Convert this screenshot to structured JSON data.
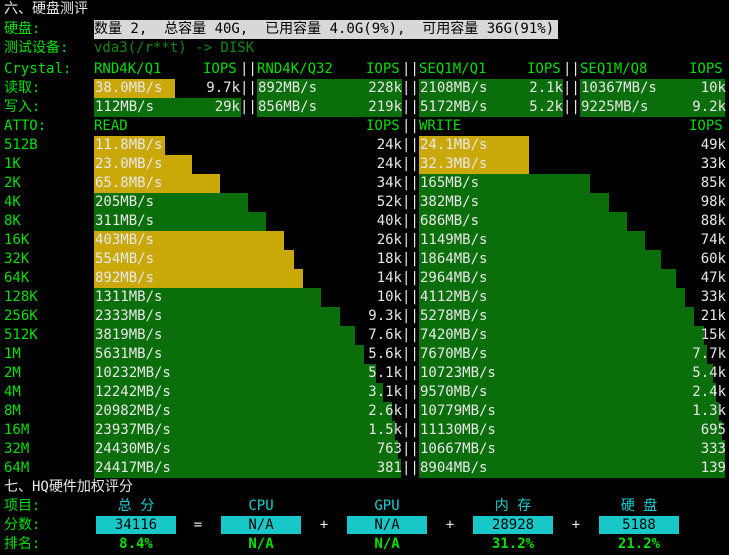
{
  "title": "六、硬盘测评",
  "disk_label": "硬盘:",
  "disk_summary": "数量 2,  总容量 40G,  已用容量 4.0G(9%),  可用容量 36G(91%)",
  "device_label": "测试设备:",
  "device_value": "vda3(/r**t) -> DISK",
  "crystal": {
    "label": "Crystal:",
    "headers": [
      "RND4K/Q1",
      "IOPS",
      "RND4K/Q32",
      "IOPS",
      "SEQ1M/Q1",
      "IOPS",
      "SEQ1M/Q8",
      "IOPS"
    ],
    "read_label": "读取:",
    "write_label": "写入:",
    "read": [
      {
        "speed": "38.0MB/s",
        "iops": "9.7k",
        "level": 0.55,
        "color": "yellow"
      },
      {
        "speed": "892MB/s",
        "iops": "228k",
        "level": 1.0,
        "color": "green"
      },
      {
        "speed": "2108MB/s",
        "iops": "2.1k",
        "level": 1.0,
        "color": "green"
      },
      {
        "speed": "10367MB/s",
        "iops": "10k",
        "level": 1.0,
        "color": "green"
      }
    ],
    "write": [
      {
        "speed": "112MB/s",
        "iops": "29k",
        "level": 1.0,
        "color": "green"
      },
      {
        "speed": "856MB/s",
        "iops": "219k",
        "level": 1.0,
        "color": "green"
      },
      {
        "speed": "5172MB/s",
        "iops": "5.2k",
        "level": 1.0,
        "color": "green"
      },
      {
        "speed": "9225MB/s",
        "iops": "9.2k",
        "level": 1.0,
        "color": "green"
      }
    ]
  },
  "atto": {
    "label": "ATTO:",
    "read_header": "READ",
    "write_header": "WRITE",
    "iops_header": "IOPS",
    "rows": [
      {
        "size": "512B",
        "read": "11.8MB/s",
        "read_iops": "24k",
        "read_level": 0.23,
        "read_color": "yellow",
        "write": "24.1MB/s",
        "write_iops": "49k",
        "write_level": 0.36,
        "write_color": "yellow"
      },
      {
        "size": "1K",
        "read": "23.0MB/s",
        "read_iops": "24k",
        "read_level": 0.32,
        "read_color": "yellow",
        "write": "32.3MB/s",
        "write_iops": "33k",
        "write_level": 0.36,
        "write_color": "yellow"
      },
      {
        "size": "2K",
        "read": "65.8MB/s",
        "read_iops": "34k",
        "read_level": 0.41,
        "read_color": "yellow",
        "write": "165MB/s",
        "write_iops": "85k",
        "write_level": 0.56,
        "write_color": "green"
      },
      {
        "size": "4K",
        "read": "205MB/s",
        "read_iops": "52k",
        "read_level": 0.5,
        "read_color": "green",
        "write": "382MB/s",
        "write_iops": "98k",
        "write_level": 0.62,
        "write_color": "green"
      },
      {
        "size": "8K",
        "read": "311MB/s",
        "read_iops": "40k",
        "read_level": 0.56,
        "read_color": "green",
        "write": "686MB/s",
        "write_iops": "88k",
        "write_level": 0.68,
        "write_color": "green"
      },
      {
        "size": "16K",
        "read": "403MB/s",
        "read_iops": "26k",
        "read_level": 0.62,
        "read_color": "yellow",
        "write": "1149MB/s",
        "write_iops": "74k",
        "write_level": 0.74,
        "write_color": "green"
      },
      {
        "size": "32K",
        "read": "554MB/s",
        "read_iops": "18k",
        "read_level": 0.65,
        "read_color": "yellow",
        "write": "1864MB/s",
        "write_iops": "60k",
        "write_level": 0.79,
        "write_color": "green"
      },
      {
        "size": "64K",
        "read": "892MB/s",
        "read_iops": "14k",
        "read_level": 0.68,
        "read_color": "yellow",
        "write": "2964MB/s",
        "write_iops": "47k",
        "write_level": 0.84,
        "write_color": "green"
      },
      {
        "size": "128K",
        "read": "1311MB/s",
        "read_iops": "10k",
        "read_level": 0.74,
        "read_color": "green",
        "write": "4112MB/s",
        "write_iops": "33k",
        "write_level": 0.87,
        "write_color": "green"
      },
      {
        "size": "256K",
        "read": "2333MB/s",
        "read_iops": "9.3k",
        "read_level": 0.8,
        "read_color": "green",
        "write": "5278MB/s",
        "write_iops": "21k",
        "write_level": 0.9,
        "write_color": "green"
      },
      {
        "size": "512K",
        "read": "3819MB/s",
        "read_iops": "7.6k",
        "read_level": 0.85,
        "read_color": "green",
        "write": "7420MB/s",
        "write_iops": "15k",
        "write_level": 0.93,
        "write_color": "green"
      },
      {
        "size": "1M",
        "read": "5631MB/s",
        "read_iops": "5.6k",
        "read_level": 0.88,
        "read_color": "green",
        "write": "7670MB/s",
        "write_iops": "7.7k",
        "write_level": 0.94,
        "write_color": "green"
      },
      {
        "size": "2M",
        "read": "10232MB/s",
        "read_iops": "5.1k",
        "read_level": 0.92,
        "read_color": "green",
        "write": "10723MB/s",
        "write_iops": "5.4k",
        "write_level": 0.96,
        "write_color": "green"
      },
      {
        "size": "4M",
        "read": "12242MB/s",
        "read_iops": "3.1k",
        "read_level": 0.94,
        "read_color": "green",
        "write": "9570MB/s",
        "write_iops": "2.4k",
        "write_level": 0.97,
        "write_color": "green"
      },
      {
        "size": "8M",
        "read": "20982MB/s",
        "read_iops": "2.6k",
        "read_level": 0.97,
        "read_color": "green",
        "write": "10779MB/s",
        "write_iops": "1.3k",
        "write_level": 0.98,
        "write_color": "green"
      },
      {
        "size": "16M",
        "read": "23937MB/s",
        "read_iops": "1.5k",
        "read_level": 0.98,
        "read_color": "green",
        "write": "11130MB/s",
        "write_iops": "695",
        "write_level": 0.99,
        "write_color": "green"
      },
      {
        "size": "32M",
        "read": "24430MB/s",
        "read_iops": "763",
        "read_level": 0.99,
        "read_color": "green",
        "write": "10667MB/s",
        "write_iops": "333",
        "write_level": 1.0,
        "write_color": "green"
      },
      {
        "size": "64M",
        "read": "24417MB/s",
        "read_iops": "381",
        "read_level": 1.0,
        "read_color": "green",
        "write": "8904MB/s",
        "write_iops": "139",
        "write_level": 1.0,
        "write_color": "green"
      }
    ]
  },
  "hq": {
    "title": "七、HQ硬件加权评分",
    "item_label": "项目:",
    "score_label": "分数:",
    "rank_label": "排名:",
    "columns": [
      "总 分",
      "CPU",
      "GPU",
      "内 存",
      "硬 盘"
    ],
    "scores": [
      "34116",
      "N/A",
      "N/A",
      "28928",
      "5188"
    ],
    "operators": [
      "=",
      "+",
      "+",
      "+"
    ],
    "ranks": [
      "8.4%",
      "N/A",
      "N/A",
      "31.2%",
      "21.2%"
    ]
  },
  "colors": {
    "green_bar": "#0a6e0a",
    "yellow_bar": "#c9a808",
    "text_green": "#00e000",
    "cyan": "#18d0d0"
  }
}
